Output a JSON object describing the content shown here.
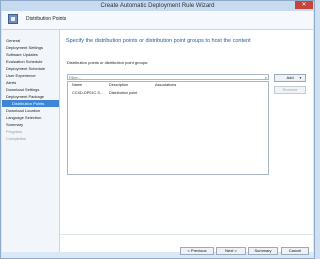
{
  "window": {
    "title": "Create Automatic Deployment Rule Wizard",
    "close_glyph": "✕"
  },
  "header": {
    "title": "Distribution Points"
  },
  "sidebar": {
    "items": [
      {
        "label": "General"
      },
      {
        "label": "Deployment Settings"
      },
      {
        "label": "Software Updates"
      },
      {
        "label": "Evaluation Schedule"
      },
      {
        "label": "Deployment Schedule"
      },
      {
        "label": "User Experience"
      },
      {
        "label": "Alerts"
      },
      {
        "label": "Download Settings"
      },
      {
        "label": "Deployment Package"
      },
      {
        "label": "Distribution Points"
      },
      {
        "label": "Download Location"
      },
      {
        "label": "Language Selection"
      },
      {
        "label": "Summary"
      },
      {
        "label": "Progress"
      },
      {
        "label": "Completion"
      }
    ]
  },
  "main": {
    "heading": "Specify the distribution points or distribution point groups to host the content",
    "list_label": "Distribution points or distribution point groups:",
    "filter": {
      "placeholder": "Filter..."
    },
    "columns": [
      "Name",
      "Description",
      "Associations"
    ],
    "rows": [
      {
        "name": "CCXD-DP01C.S...",
        "description": "Distribution point",
        "associations": ""
      }
    ],
    "add_button": "Add",
    "remove_button": "Remove"
  },
  "footer": {
    "previous": "< Previous",
    "next": "Next >",
    "summary": "Summary",
    "cancel": "Cancel"
  }
}
